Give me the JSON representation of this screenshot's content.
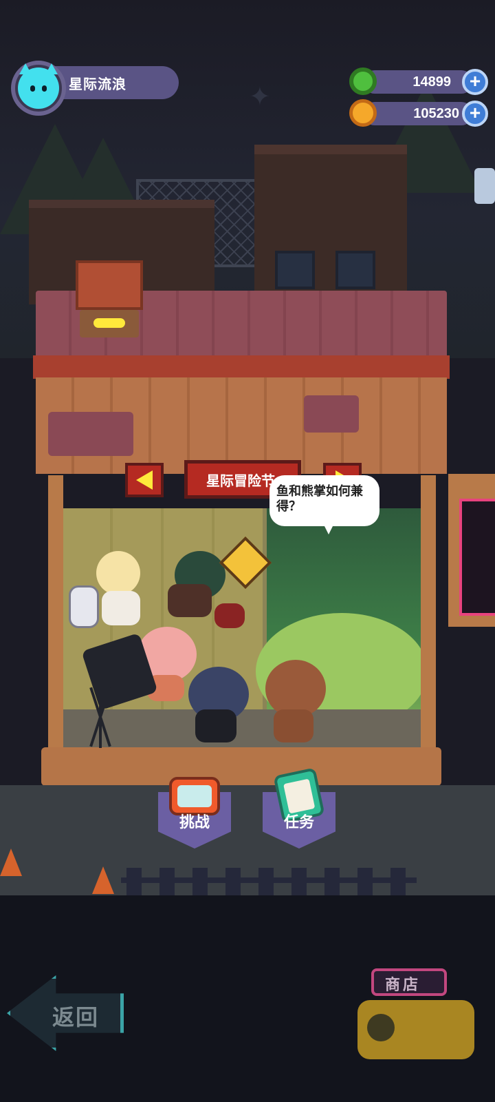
{
  "profile": {
    "name": "星际流浪"
  },
  "currency": {
    "gems": "14899",
    "coins": "105230",
    "add_symbol": "+"
  },
  "shop_sign": {
    "title": "星际冒险节"
  },
  "speech_bubble": {
    "text": "鱼和熊掌如何兼得？"
  },
  "menu": {
    "challenge_label": "挑战",
    "tasks_label": "任务"
  },
  "navigation": {
    "back_label": "返回",
    "shop_label": "商店"
  },
  "colors": {
    "ui_pill": "#5a5485",
    "plus_button": "#3f7dd6",
    "sign_red": "#b52a22",
    "sign_arrow": "#ffe93b",
    "avatar": "#43e0ee",
    "menu_purple": "#6b5fa3"
  },
  "icons": {
    "avatar": "cat-avatar-icon",
    "gems": "green-gem-icon",
    "coins": "planet-coin-icon",
    "challenge": "tv-icon",
    "tasks": "clipboard-icon",
    "back": "back-arrow-icon"
  }
}
